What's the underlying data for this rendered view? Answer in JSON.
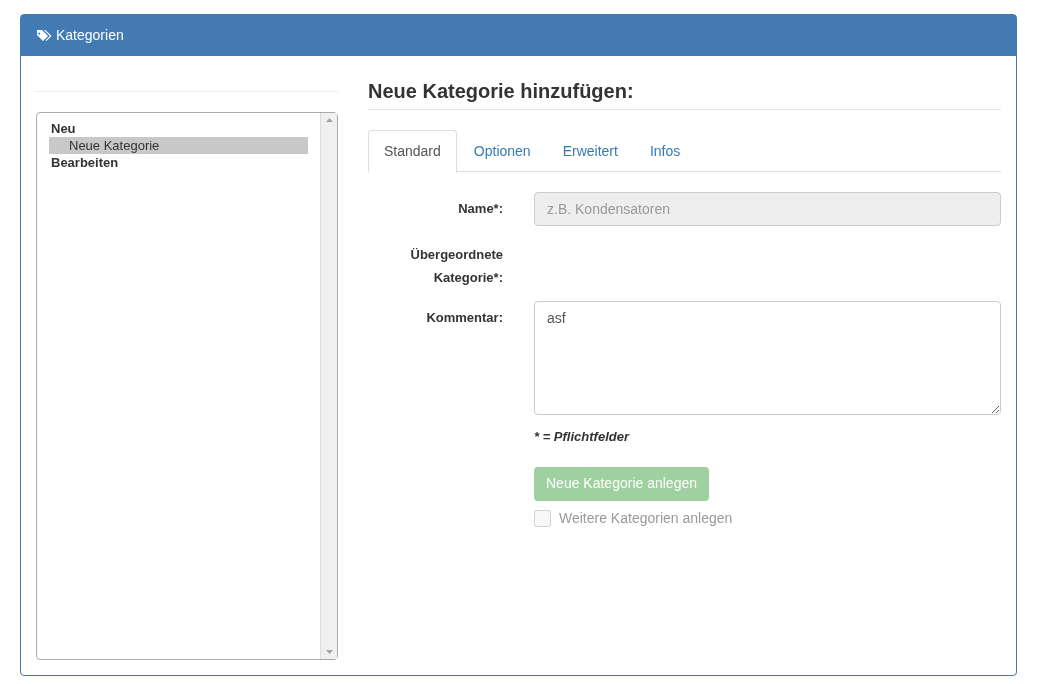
{
  "panel": {
    "title": "Kategorien"
  },
  "tree": [
    {
      "label": "Neu",
      "selected": false,
      "children": [
        {
          "label": "Neue Kategorie",
          "selected": true
        }
      ]
    },
    {
      "label": "Bearbeiten",
      "selected": false
    }
  ],
  "form": {
    "heading": "Neue Kategorie hinzufügen:",
    "tabs": [
      {
        "label": "Standard",
        "selected": true
      },
      {
        "label": "Optionen",
        "selected": false
      },
      {
        "label": "Erweitert",
        "selected": false
      },
      {
        "label": "Infos",
        "selected": false
      }
    ],
    "fields": [
      {
        "kind": "input",
        "label": "Name*:",
        "placeholder": "z.B. Kondensatoren",
        "disabled": true
      },
      {
        "kind": "empty",
        "label": "Übergeordnete Kategorie*:"
      },
      {
        "kind": "textarea",
        "label": "Kommentar:",
        "value": "asf"
      }
    ],
    "required_note": "* = Pflichtfelder",
    "submit": {
      "label": "Neue Kategorie anlegen",
      "disabled": true
    },
    "more_checkbox": {
      "label": "Weitere Kategorien anlegen",
      "checked": false,
      "disabled": true
    }
  }
}
